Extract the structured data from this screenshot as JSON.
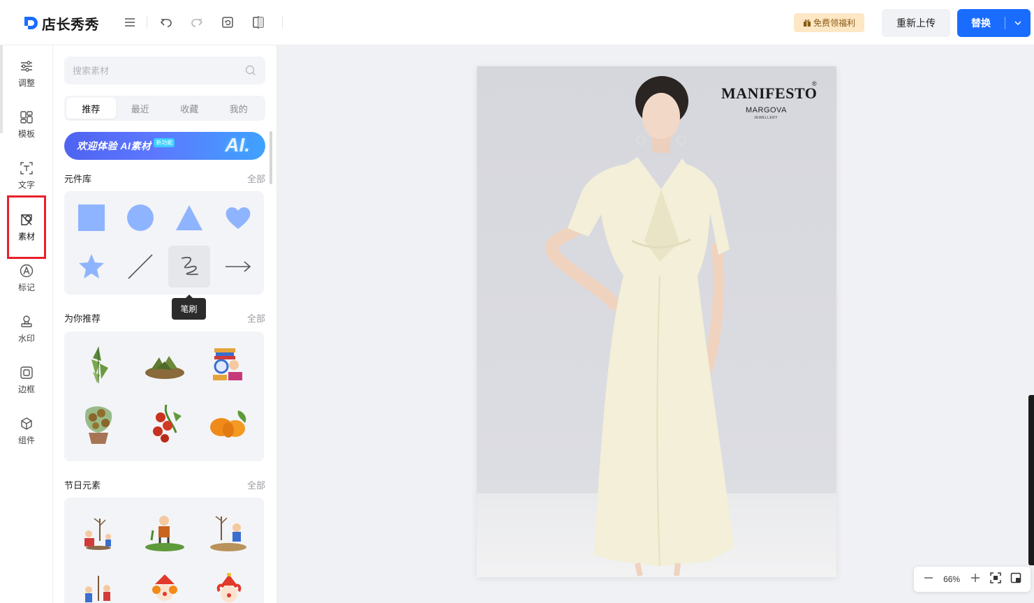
{
  "app": {
    "name": "店长秀秀"
  },
  "toolbar": {
    "icons": [
      "menu-icon",
      "undo-icon",
      "redo-icon",
      "reset-icon",
      "compare-icon"
    ],
    "gift_label": "免费领福利",
    "reupload_label": "重新上传",
    "replace_label": "替换"
  },
  "sidebar": {
    "items": [
      {
        "label": "调整",
        "icon": "sliders-icon"
      },
      {
        "label": "模板",
        "icon": "template-icon"
      },
      {
        "label": "文字",
        "icon": "text-icon"
      },
      {
        "label": "素材",
        "icon": "material-icon",
        "active": true
      },
      {
        "label": "标记",
        "icon": "mark-icon"
      },
      {
        "label": "水印",
        "icon": "stamp-icon"
      },
      {
        "label": "边框",
        "icon": "frame-icon"
      },
      {
        "label": "组件",
        "icon": "component-icon"
      }
    ]
  },
  "panel": {
    "search_placeholder": "搜索素材",
    "tabs": [
      "推荐",
      "最近",
      "收藏",
      "我的"
    ],
    "active_tab": "推荐",
    "ai_banner": {
      "text": "欢迎体验 AI素材",
      "badge": "新功能",
      "big": "AI."
    },
    "sections": [
      {
        "title": "元件库",
        "more": "全部"
      },
      {
        "title": "为你推荐",
        "more": "全部"
      },
      {
        "title": "节日元素",
        "more": "全部"
      }
    ],
    "shapes": [
      "square-shape",
      "circle-shape",
      "triangle-shape",
      "heart-shape",
      "star-shape",
      "line-shape",
      "brush-shape",
      "arrow-shape"
    ],
    "tooltip": "笔刷",
    "recommend_stickers": [
      "zongzi-leaf-sticker",
      "zongzi-plate-sticker",
      "reading-child-sticker",
      "tomato-plant-sticker",
      "tomatoes-sticker",
      "pumpkin-sticker"
    ],
    "holiday_stickers": [
      "planting-tree-sticker",
      "digging-boy-sticker",
      "watering-kids-sticker",
      "kids-tree-sticker",
      "clown-sticker",
      "clown-girl-sticker"
    ]
  },
  "canvas": {
    "brand": "MANIFESTO",
    "brand_reg": "®",
    "brand_sub": "MARGOVA",
    "brand_sub2": "JEWELLERY",
    "zoom": "66%"
  },
  "colors": {
    "accent": "#1a6cff",
    "active_outline": "#e8202a",
    "shape_blue": "#8fb4ff"
  }
}
